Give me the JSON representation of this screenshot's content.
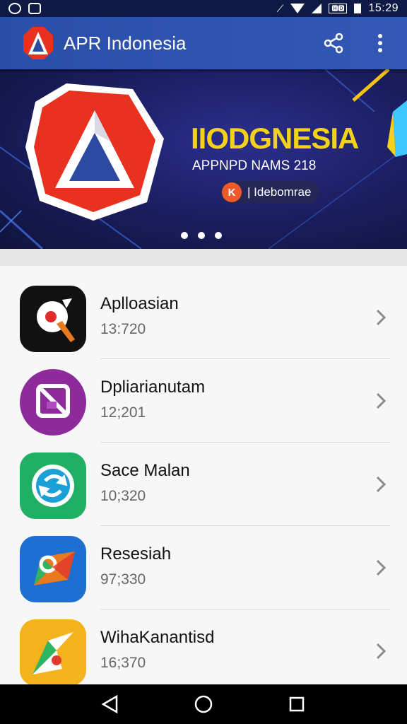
{
  "status_bar": {
    "time": "15:29",
    "badge": "🅷🅳"
  },
  "app_bar": {
    "title": "APR Indonesia"
  },
  "banner": {
    "headline": "IIODGNESIA",
    "subtitle": "APPNPD NAMS 218",
    "chip_icon_letter": "K",
    "chip_text": "| Idebomrae",
    "slides": 3
  },
  "apps": [
    {
      "name": "Aplloasian",
      "meta": "13:720",
      "icon": "pin-icon",
      "color": "#111111"
    },
    {
      "name": "Dpliarianutam",
      "meta": "12;201",
      "icon": "crop-icon",
      "color": "#8e2a9c"
    },
    {
      "name": "Sace Malan",
      "meta": "10;320",
      "icon": "sync-icon",
      "color": "#1fb063"
    },
    {
      "name": "Resesiah",
      "meta": "97;330",
      "icon": "map-icon",
      "color": "#1d6fd1"
    },
    {
      "name": "WihaKanantisd",
      "meta": "16;370",
      "icon": "maps-pin-icon",
      "color": "#f4b21d"
    }
  ],
  "colors": {
    "app_bar": "#2f55b3",
    "headline": "#f5d21a",
    "accent_red": "#e8321f"
  }
}
